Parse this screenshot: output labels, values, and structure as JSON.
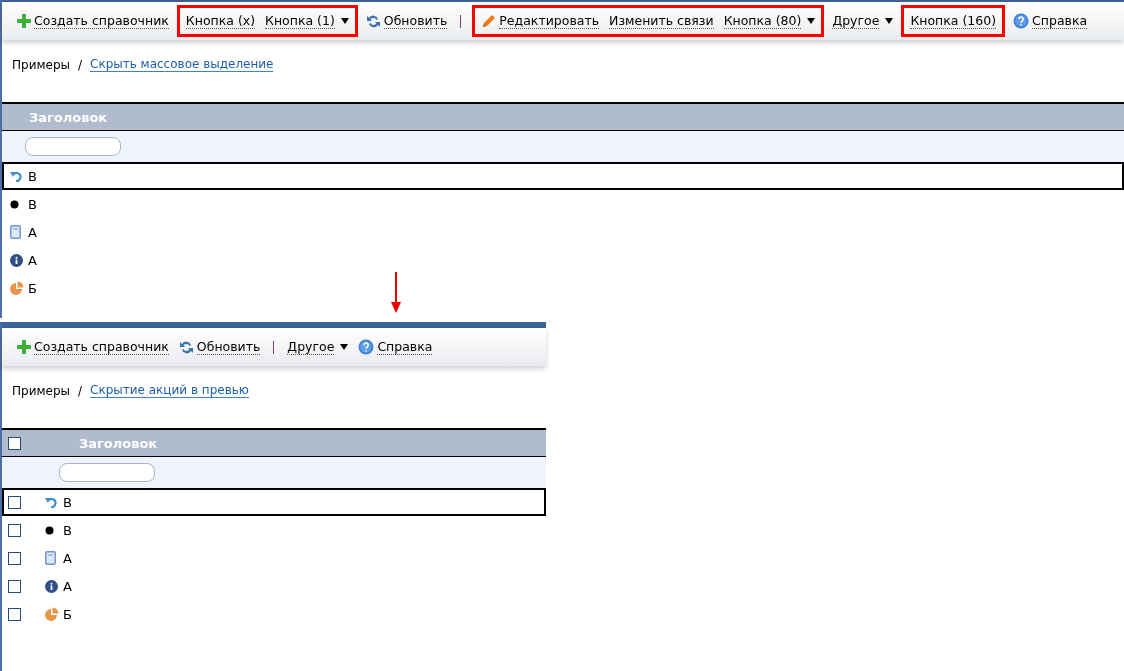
{
  "panels": [
    {
      "toolbar": [
        {
          "kind": "create",
          "label": "Создать справочник",
          "dropdown": false
        },
        {
          "kind": "highlight",
          "items": [
            {
              "kind": "plain",
              "label": "Кнопка (x)",
              "dropdown": false
            },
            {
              "kind": "plain",
              "label": "Кнопка (1)",
              "dropdown": true
            }
          ]
        },
        {
          "kind": "refresh",
          "label": "Обновить",
          "dropdown": false
        },
        {
          "kind": "separator"
        },
        {
          "kind": "highlight",
          "items": [
            {
              "kind": "edit",
              "label": "Редактировать",
              "dropdown": false
            },
            {
              "kind": "plain",
              "label": "Изменить связи",
              "dropdown": false
            },
            {
              "kind": "plain",
              "label": "Кнопка (80)",
              "dropdown": true
            }
          ]
        },
        {
          "kind": "plain",
          "label": "Другое",
          "dropdown": true
        },
        {
          "kind": "highlight",
          "items": [
            {
              "kind": "plain",
              "label": "Кнопка (160)",
              "dropdown": false
            }
          ]
        },
        {
          "kind": "help",
          "label": "Справка",
          "dropdown": false
        }
      ],
      "breadcrumb": {
        "root": "Примеры",
        "separator": "/",
        "link": "Скрыть массовое выделение"
      },
      "table": {
        "checkboxes": false,
        "column": "Заголовок",
        "rows": [
          {
            "kind": "undo",
            "label": "В",
            "selected": true
          },
          {
            "kind": "dot",
            "label": "В",
            "selected": false
          },
          {
            "kind": "document",
            "label": "А",
            "selected": false
          },
          {
            "kind": "info",
            "label": "А",
            "selected": false
          },
          {
            "kind": "pie",
            "label": "Б",
            "selected": false
          }
        ]
      }
    },
    {
      "toolbar": [
        {
          "kind": "create",
          "label": "Создать справочник",
          "dropdown": false
        },
        {
          "kind": "refresh",
          "label": "Обновить",
          "dropdown": false
        },
        {
          "kind": "separator"
        },
        {
          "kind": "plain",
          "label": "Другое",
          "dropdown": true
        },
        {
          "kind": "help",
          "label": "Справка",
          "dropdown": false
        }
      ],
      "breadcrumb": {
        "root": "Примеры",
        "separator": "/",
        "link": "Скрытие акций в превью"
      },
      "table": {
        "checkboxes": true,
        "header_checked": false,
        "column": "Заголовок",
        "rows": [
          {
            "kind": "undo",
            "label": "В",
            "selected": true,
            "checked": false
          },
          {
            "kind": "dot",
            "label": "В",
            "selected": false,
            "checked": false
          },
          {
            "kind": "document",
            "label": "А",
            "selected": false,
            "checked": false
          },
          {
            "kind": "info",
            "label": "А",
            "selected": false,
            "checked": false
          },
          {
            "kind": "pie",
            "label": "Б",
            "selected": false,
            "checked": false
          }
        ]
      }
    }
  ]
}
